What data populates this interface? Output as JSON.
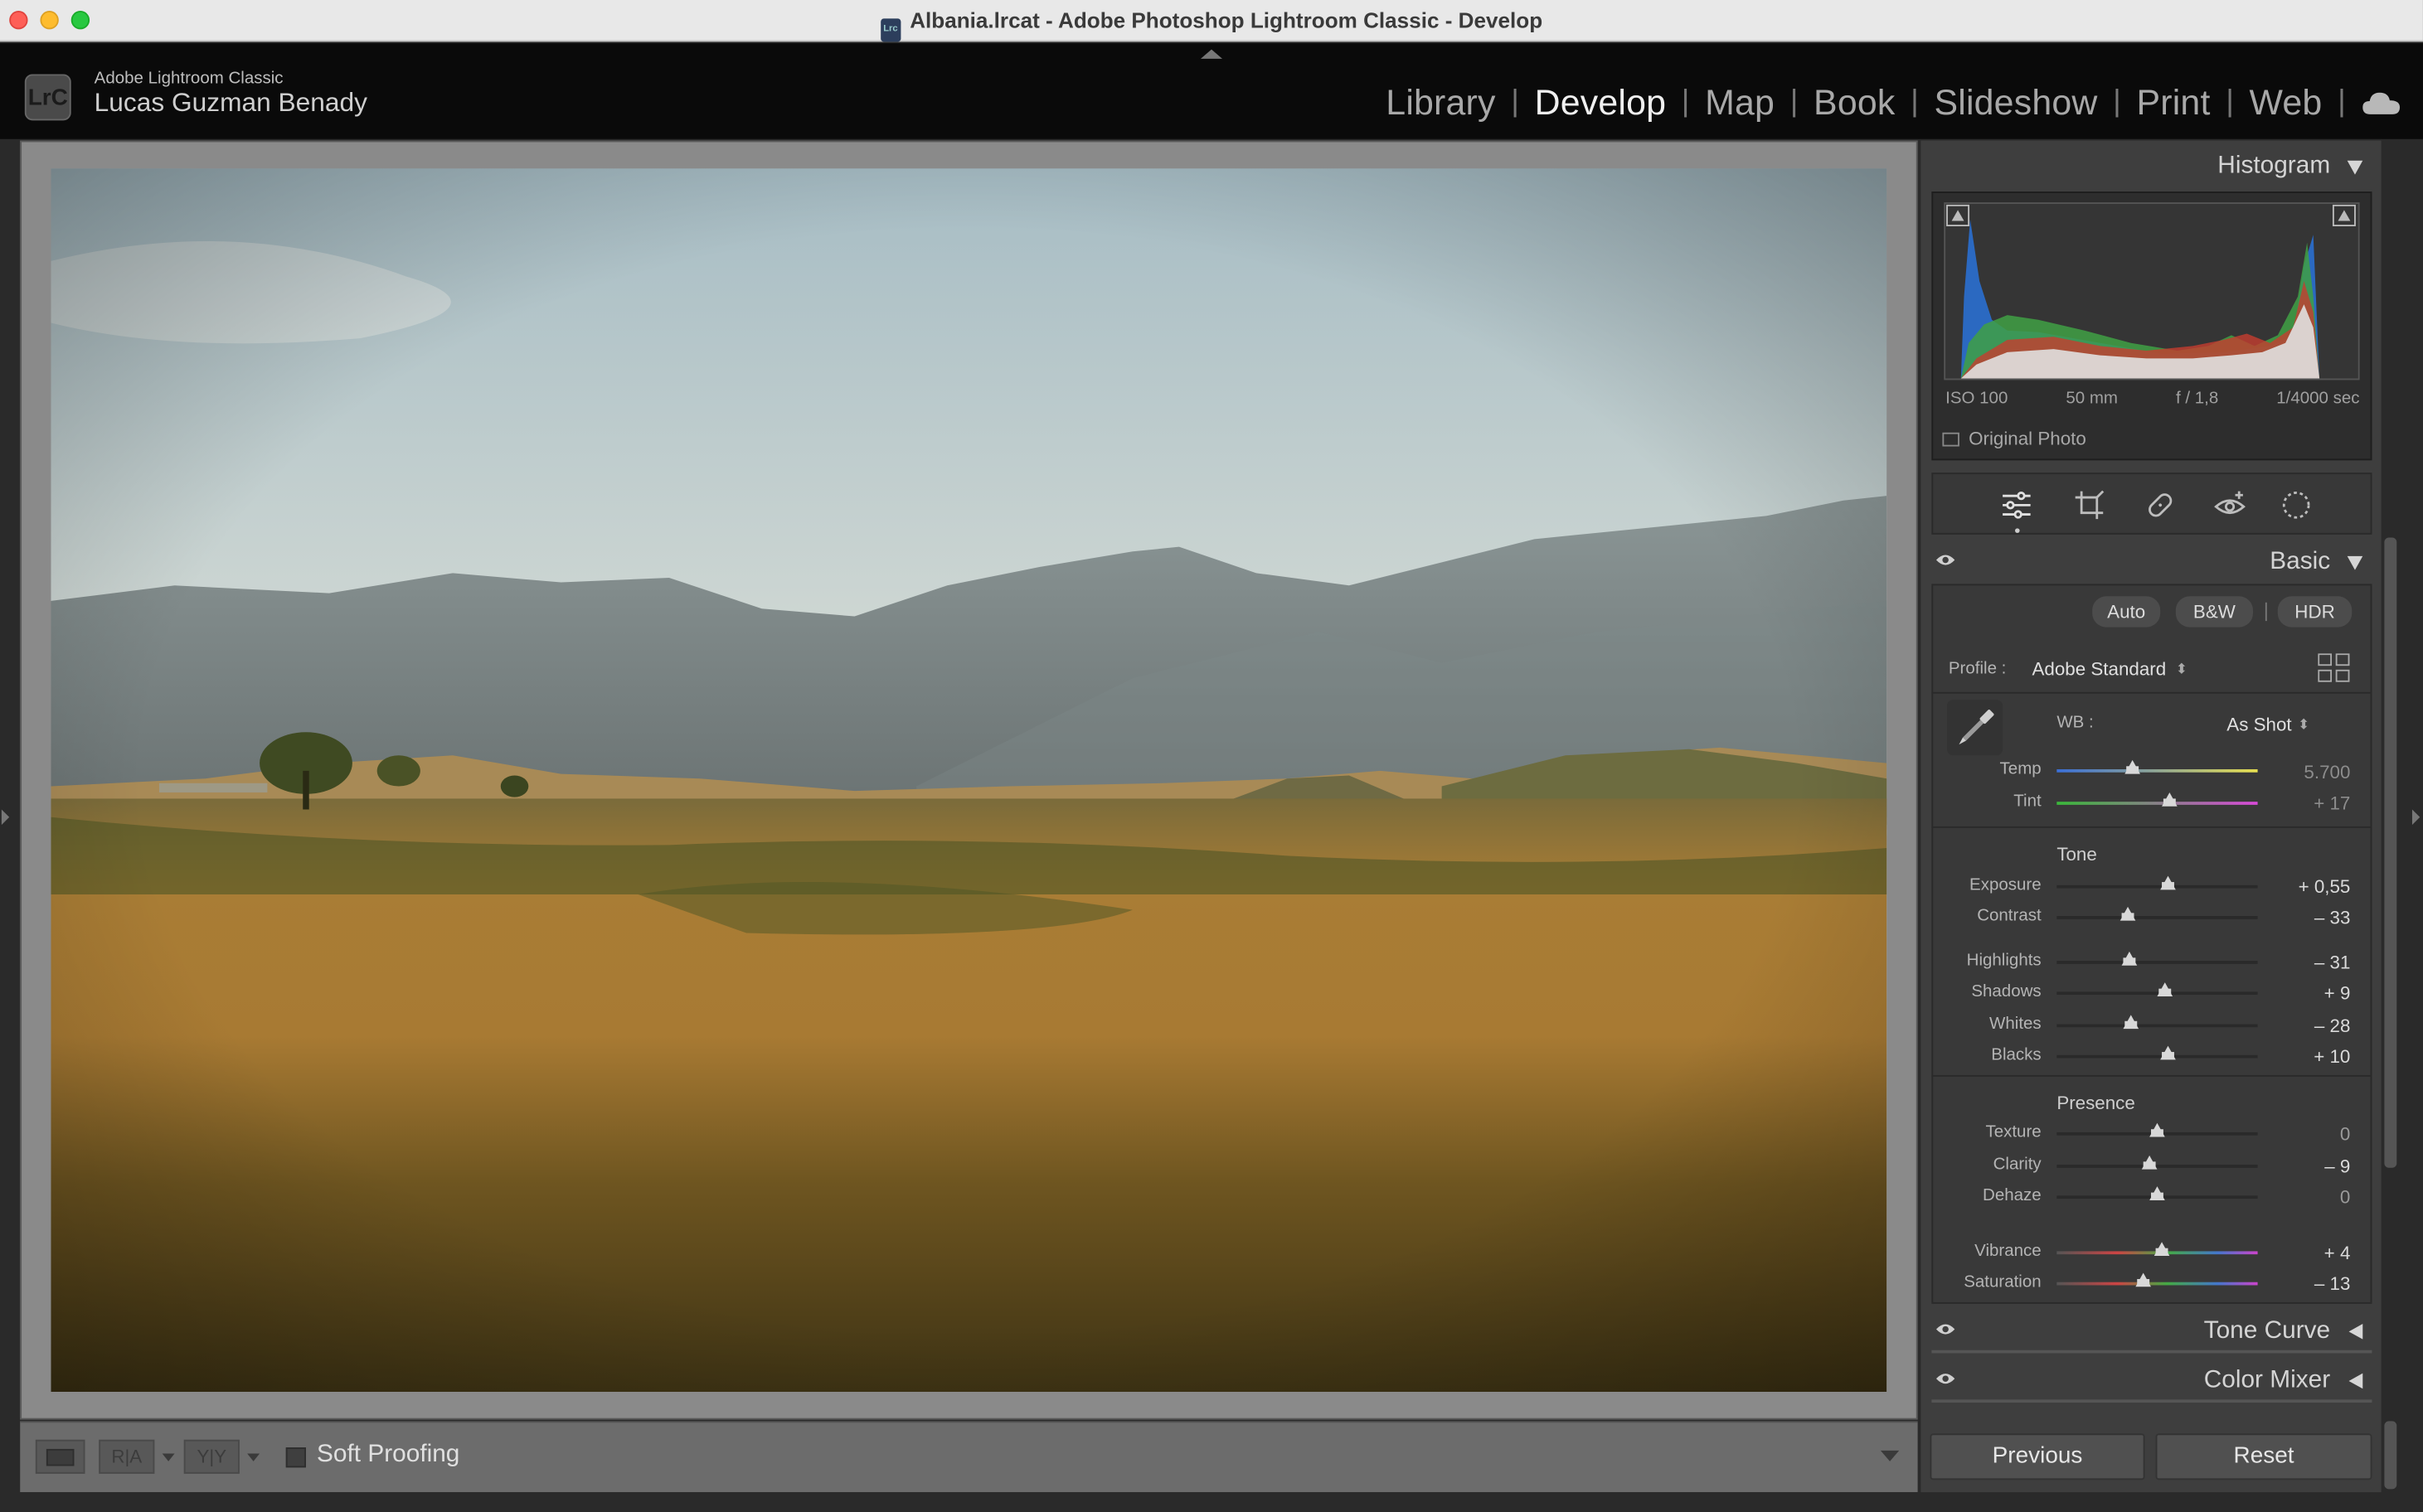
{
  "window": {
    "title": "Albania.lrcat - Adobe Photoshop Lightroom Classic - Develop",
    "doc_icon": "Lrc"
  },
  "identity": {
    "logo": "LrC",
    "app_name": "Adobe Lightroom Classic",
    "user": "Lucas Guzman Benady"
  },
  "modules": [
    {
      "label": "Library",
      "active": false
    },
    {
      "label": "Develop",
      "active": true
    },
    {
      "label": "Map",
      "active": false
    },
    {
      "label": "Book",
      "active": false
    },
    {
      "label": "Slideshow",
      "active": false
    },
    {
      "label": "Print",
      "active": false
    },
    {
      "label": "Web",
      "active": false
    }
  ],
  "toolbar": {
    "ra_label": "R|A",
    "yy_label": "Y|Y",
    "soft_proofing": "Soft Proofing",
    "soft_proofing_checked": false
  },
  "histogram": {
    "title": "Histogram",
    "iso": "ISO 100",
    "focal": "50 mm",
    "aperture": "f / 1,8",
    "shutter": "1/4000 sec",
    "original_photo": "Original Photo"
  },
  "basic": {
    "title": "Basic",
    "buttons": {
      "auto": "Auto",
      "bw": "B&W",
      "hdr": "HDR"
    },
    "profile_label": "Profile :",
    "profile_value": "Adobe Standard",
    "wb_label": "WB :",
    "wb_value": "As Shot",
    "temp": {
      "label": "Temp",
      "value": "5.700",
      "pos": 0.38
    },
    "tint": {
      "label": "Tint",
      "value": "+ 17",
      "pos": 0.56
    },
    "tone_title": "Tone",
    "tone": [
      {
        "label": "Exposure",
        "value": "+ 0,55",
        "pos": 0.55
      },
      {
        "label": "Contrast",
        "value": "– 33",
        "pos": 0.35
      },
      {
        "label": "Highlights",
        "value": "– 31",
        "pos": 0.36
      },
      {
        "label": "Shadows",
        "value": "+ 9",
        "pos": 0.54
      },
      {
        "label": "Whites",
        "value": "– 28",
        "pos": 0.37
      },
      {
        "label": "Blacks",
        "value": "+ 10",
        "pos": 0.55
      }
    ],
    "presence_title": "Presence",
    "presence": [
      {
        "label": "Texture",
        "value": "0",
        "pos": 0.5
      },
      {
        "label": "Clarity",
        "value": "– 9",
        "pos": 0.46
      },
      {
        "label": "Dehaze",
        "value": "0",
        "pos": 0.5
      }
    ],
    "color": [
      {
        "label": "Vibrance",
        "value": "+ 4",
        "pos": 0.52
      },
      {
        "label": "Saturation",
        "value": "– 13",
        "pos": 0.43
      }
    ]
  },
  "tone_curve": {
    "title": "Tone Curve"
  },
  "color_mixer": {
    "title": "Color Mixer"
  },
  "footer": {
    "previous": "Previous",
    "reset": "Reset"
  }
}
